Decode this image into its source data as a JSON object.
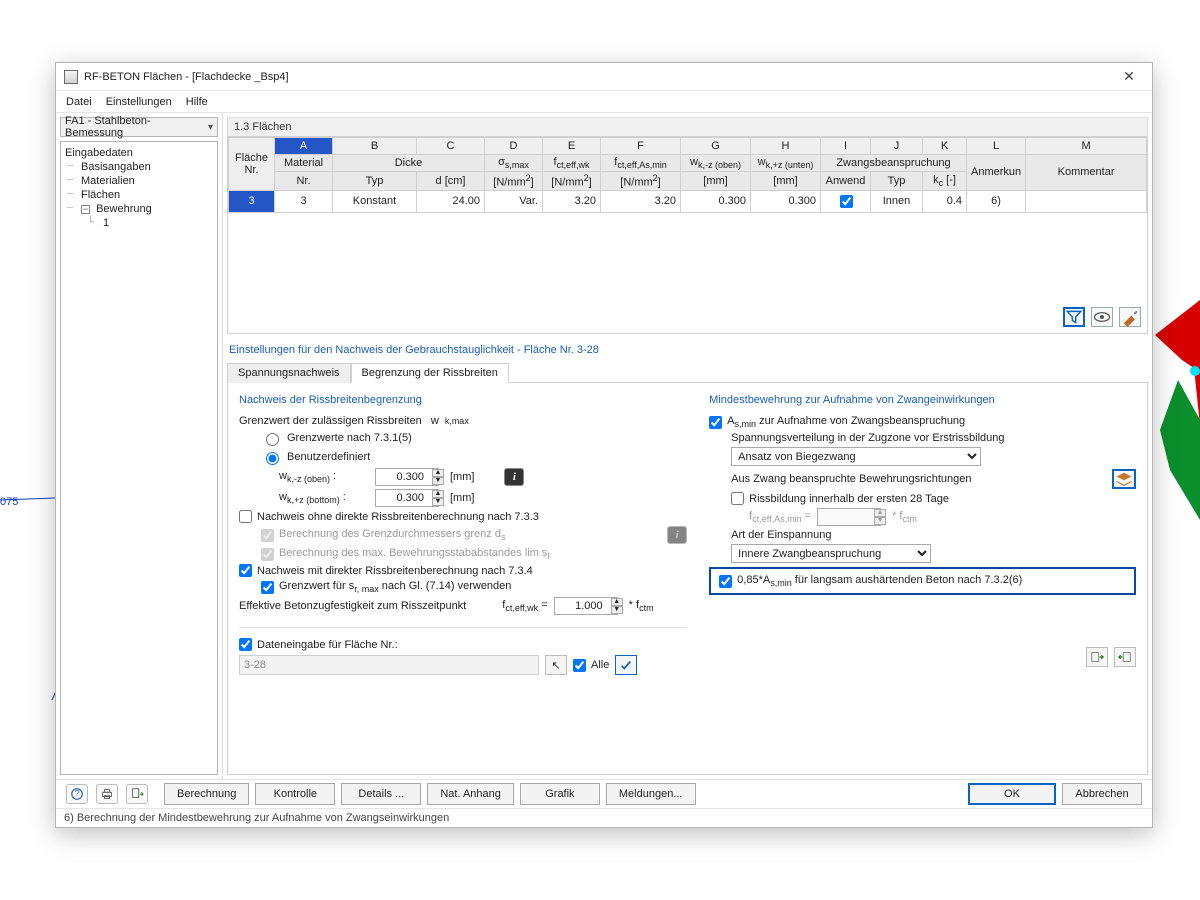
{
  "window": {
    "title": "RF-BETON Flächen - [Flachdecke _Bsp4]"
  },
  "menus": [
    "Datei",
    "Einstellungen",
    "Hilfe"
  ],
  "sidebar": {
    "dropdown": "FA1 - Stahlbeton-Bemessung",
    "tree": {
      "root": "Eingabedaten",
      "items": [
        "Basisangaben",
        "Materialien",
        "Flächen",
        "Bewehrung"
      ],
      "sub": [
        "1"
      ]
    }
  },
  "grid": {
    "title": "1.3 Flächen",
    "hdr_flaeche": [
      "Fläche",
      "Nr."
    ],
    "hdr1": [
      "Material",
      "Dicke",
      "",
      "",
      "",
      "",
      "",
      "",
      "Zwangsbeanspruchung"
    ],
    "hdr2": [
      "Nr.",
      "Typ",
      "d [cm]",
      "",
      "",
      "",
      "[mm]",
      "[mm]",
      "Anwend",
      "Typ",
      "",
      "Anmerkun",
      "Kommentar"
    ],
    "row": [
      "3",
      "3",
      "Konstant",
      "24.00",
      "Var.",
      "3.20",
      "3.20",
      "0.300",
      "0.300",
      "",
      "Innen",
      "0.4",
      "6)"
    ]
  },
  "settings": {
    "heading": "Einstellungen für den Nachweis der Gebrauchstauglichkeit - Fläche Nr. 3-28",
    "tabs": [
      "Spannungsnachweis",
      "Begrenzung der Rissbreiten"
    ]
  },
  "left": {
    "title": "Nachweis der Rissbreitenbegrenzung",
    "limit_label_pre": "Grenzwert der zulässigen Rissbreiten",
    "radio1": "Grenzwerte nach 7.3.1(5)",
    "radio2": "Benutzerdefiniert",
    "wk_oben": "0.300",
    "wk_unten": "0.300",
    "unit_mm": "[mm]",
    "chk_733": "Nachweis ohne direkte Rissbreitenberechnung nach 7.3.3",
    "chk_ds_pre": "Berechnung des Grenzdurchmessers  grenz",
    "chk_sl_pre": "Berechnung des max. Bewehrungsstababstandes lim",
    "chk_734": "Nachweis mit direkter Rissbreitenberechnung nach 7.3.4",
    "chk_714_pre": "Grenzwert für",
    "chk_714_post": "nach Gl. (7.14) verwenden",
    "fcteff_label": "Effektive Betonzugfestigkeit zum Risszeitpunkt",
    "fcteff": "1.000"
  },
  "right": {
    "title": "Mindestbewehrung zur Aufnahme von Zwangeinwirkungen",
    "asmin_label": "zur Aufnahme von Zwangsbeanspruchung",
    "stress_dist": "Spannungsverteilung in der Zugzone vor Erstrissbildung",
    "bending_option": "Ansatz von Biegezwang",
    "reinf_dirs": "Aus Zwang beanspruchte Bewehrungsrichtungen",
    "chk_28": "Rissbildung innerhalb der ersten 28 Tage",
    "restraint_label": "Art der Einspannung",
    "restraint_option": "Innere Zwangbeanspruchung",
    "chk_085": "für langsam aushärtenden Beton nach 7.3.2(6)"
  },
  "bottom": {
    "data_entry_label": "Dateneingabe für Fläche Nr.:",
    "surfaces": "3-28",
    "all_label": "Alle"
  },
  "buttons": [
    "Berechnung",
    "Kontrolle",
    "Details ...",
    "Nat. Anhang",
    "Grafik",
    "Meldungen...",
    "OK",
    "Abbrechen"
  ],
  "status": "6) Berechnung der Mindestbewehrung zur Aufnahme von Zwangseinwirkungen"
}
